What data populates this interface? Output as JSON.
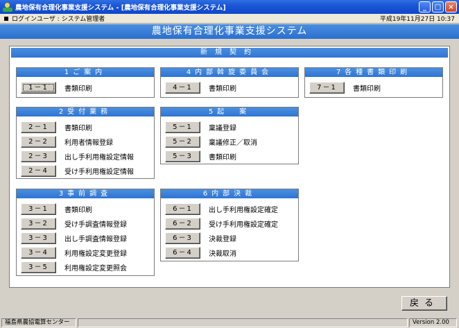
{
  "window": {
    "title": "農地保有合理化事業支援システム - [農地保有合理化事業支援システム]",
    "buttons": [
      "_",
      "□",
      "×"
    ]
  },
  "infobar": {
    "user": "ログインユーザ : システム管理者",
    "datetime": "平成19年11月27日 10:37"
  },
  "banner": "農地保有合理化事業支援システム",
  "panel_title": "新規契約",
  "groups": {
    "g1": {
      "title": "1ご案内",
      "items": [
        {
          "code": "1－1",
          "label": "書類印刷"
        }
      ]
    },
    "g4": {
      "title": "4内部斡旋委員会",
      "items": [
        {
          "code": "4－1",
          "label": "書類印刷"
        }
      ]
    },
    "g7": {
      "title": "7各種書類印刷",
      "items": [
        {
          "code": "7－1",
          "label": "書類印刷"
        }
      ]
    },
    "g2": {
      "title": "2受付業務",
      "items": [
        {
          "code": "2－1",
          "label": "書類印刷"
        },
        {
          "code": "2－2",
          "label": "利用者情報登録"
        },
        {
          "code": "2－3",
          "label": "出し手利用権設定情報"
        },
        {
          "code": "2－4",
          "label": "受け手利用権設定情報"
        }
      ]
    },
    "g5": {
      "title": "5起　案",
      "items": [
        {
          "code": "5－1",
          "label": "稟議登録"
        },
        {
          "code": "5－2",
          "label": "稟議修正／取消"
        },
        {
          "code": "5－3",
          "label": "書類印刷"
        }
      ]
    },
    "g3": {
      "title": "3事前調査",
      "items": [
        {
          "code": "3－1",
          "label": "書類印刷"
        },
        {
          "code": "3－2",
          "label": "受け手調査情報登録"
        },
        {
          "code": "3－3",
          "label": "出し手調査情報登録"
        },
        {
          "code": "3－4",
          "label": "利用権設定変更登録"
        },
        {
          "code": "3－5",
          "label": "利用権設定変更照会"
        }
      ]
    },
    "g6": {
      "title": "6内部決裁",
      "items": [
        {
          "code": "6－1",
          "label": "出し手利用権設定確定"
        },
        {
          "code": "6－2",
          "label": "受け手利用権設定確定"
        },
        {
          "code": "6－3",
          "label": "決裁登録"
        },
        {
          "code": "6－4",
          "label": "決裁取消"
        }
      ]
    }
  },
  "back_button": "戻る",
  "status": {
    "org": "福島県農協電算センター",
    "version": "Version 2.00"
  }
}
